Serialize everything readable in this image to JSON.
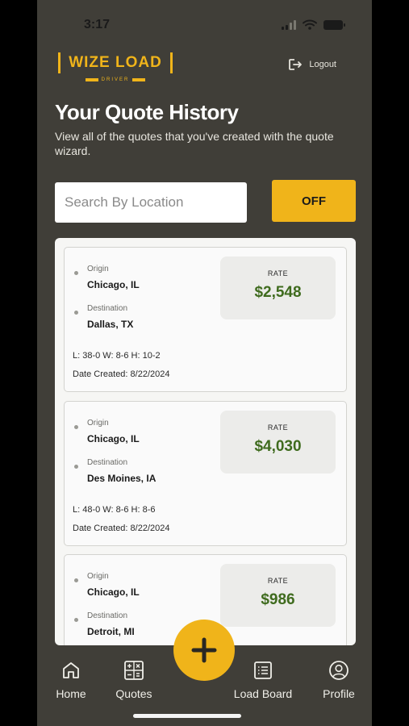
{
  "status_bar": {
    "time": "3:17"
  },
  "header": {
    "logo_text": "WIZE LOAD",
    "logo_sub": "DRIVER",
    "logout_label": "Logout"
  },
  "page": {
    "title": "Your Quote History",
    "description": "View all of the quotes that you've created with the quote wizard."
  },
  "search": {
    "placeholder": "Search By Location",
    "value": ""
  },
  "toggle": {
    "label": "OFF"
  },
  "quote_labels": {
    "origin": "Origin",
    "destination": "Destination",
    "rate": "RATE"
  },
  "quotes": [
    {
      "origin": "Chicago, IL",
      "destination": "Dallas, TX",
      "dims": "L: 38-0 W: 8-6 H: 10-2",
      "date": "Date Created: 8/22/2024",
      "rate": "$2,548"
    },
    {
      "origin": "Chicago, IL",
      "destination": "Des Moines, IA",
      "dims": "L: 48-0 W: 8-6 H: 8-6",
      "date": "Date Created: 8/22/2024",
      "rate": "$4,030"
    },
    {
      "origin": "Chicago, IL",
      "destination": "Detroit, MI",
      "dims": "",
      "date": "",
      "rate": "$986"
    }
  ],
  "nav": {
    "home": "Home",
    "quotes": "Quotes",
    "load_board": "Load Board",
    "profile": "Profile"
  },
  "colors": {
    "brand_yellow": "#f0b41a",
    "background": "#403e38",
    "rate_green": "#3f6b1e"
  },
  "icons": [
    "wifi-icon",
    "battery-icon",
    "logout-icon",
    "home-icon",
    "calculator-icon",
    "plus-icon",
    "list-icon",
    "profile-icon"
  ]
}
